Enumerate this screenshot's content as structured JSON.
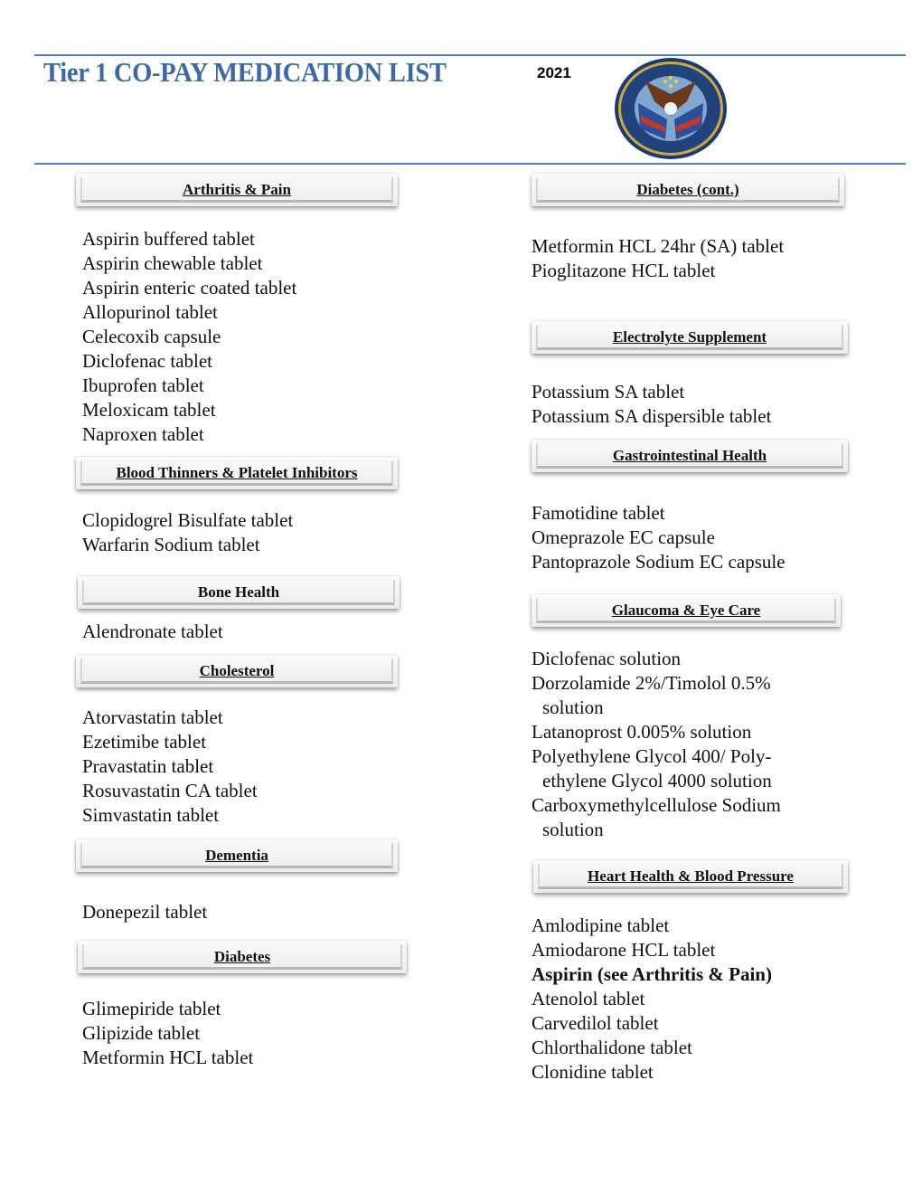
{
  "header": {
    "title": "Tier 1 CO-PAY MEDICATION LIST",
    "year": "2021",
    "logo": "department-of-veterans-affairs-seal"
  },
  "left_column": [
    {
      "heading": "Arthritis & Pain",
      "items": [
        "Aspirin buffered tablet",
        "Aspirin chewable tablet",
        "Aspirin enteric coated tablet",
        "Allopurinol tablet",
        "Celecoxib capsule",
        "Diclofenac tablet",
        "Ibuprofen tablet",
        "Meloxicam tablet",
        "Naproxen tablet"
      ]
    },
    {
      "heading": "Blood Thinners & Platelet Inhibitors",
      "items": [
        "Clopidogrel Bisulfate tablet",
        "Warfarin Sodium tablet"
      ]
    },
    {
      "heading": "Bone Health",
      "items": [
        "Alendronate tablet"
      ]
    },
    {
      "heading": "Cholesterol",
      "items": [
        "Atorvastatin tablet",
        "Ezetimibe tablet",
        "Pravastatin tablet",
        "Rosuvastatin CA tablet",
        "Simvastatin tablet"
      ]
    },
    {
      "heading": "Dementia",
      "items": [
        "Donepezil tablet"
      ]
    },
    {
      "heading": "Diabetes",
      "items": [
        "Glimepiride tablet",
        "Glipizide tablet",
        "Metformin HCL tablet"
      ]
    }
  ],
  "right_column": [
    {
      "heading": "Diabetes (cont.)",
      "items": [
        "Metformin HCL 24hr (SA) tablet",
        "Pioglitazone HCL tablet"
      ]
    },
    {
      "heading": "Electrolyte Supplement",
      "items": [
        "Potassium SA tablet",
        "Potassium SA dispersible tablet"
      ]
    },
    {
      "heading": "Gastrointestinal Health",
      "items": [
        "Famotidine tablet",
        "Omeprazole EC capsule",
        "Pantoprazole Sodium EC capsule"
      ]
    },
    {
      "heading": "Glaucoma & Eye Care",
      "items": [
        "Diclofenac solution",
        "Dorzolamide 2%/Timolol 0.5%",
        "solution",
        "Latanoprost 0.005% solution",
        "Polyethylene Glycol 400/ Poly-",
        "ethylene Glycol 4000 solution",
        "Carboxymethylcellulose Sodium",
        "solution"
      ]
    },
    {
      "heading": "Heart Health & Blood Pressure",
      "items": [
        "Amlodipine tablet",
        "Amiodarone HCL tablet",
        "Aspirin (see Arthritis & Pain)",
        "Atenolol tablet",
        "Carvedilol tablet",
        "Chlorthalidone tablet",
        "Clonidine tablet"
      ]
    }
  ]
}
